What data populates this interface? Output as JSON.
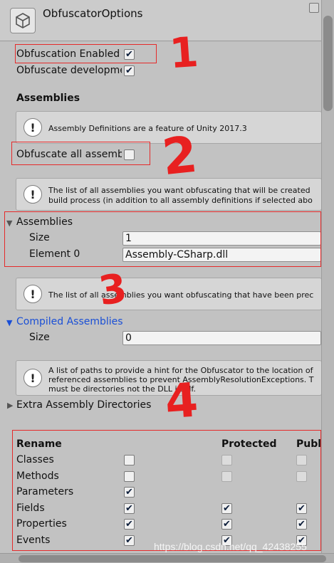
{
  "header": {
    "title": "ObfuscatorOptions",
    "icon": "unity-cube-icon"
  },
  "options": {
    "obfuscation_enabled_label": "Obfuscation Enabled",
    "obfuscate_dev_label": "Obfuscate developme",
    "obfuscation_enabled": true,
    "obfuscate_dev": true
  },
  "assemblies": {
    "heading": "Assemblies",
    "help1": "Assembly Definitions are a feature of Unity 2017.3",
    "obfuscate_all_label": "Obfuscate all assemb",
    "obfuscate_all": false,
    "help2_line1": "The list of all assemblies you want obfuscating that will be created",
    "help2_line2": "build process (in addition to all assembly definitions if selected abo",
    "list_label": "Assemblies",
    "size_label": "Size",
    "size_value": "1",
    "element0_label": "Element 0",
    "element0_value": "Assembly-CSharp.dll",
    "help3": "The list of all assemblies you want obfuscating that have been prec"
  },
  "compiled": {
    "label": "Compiled Assemblies",
    "size_label": "Size",
    "size_value": "0",
    "help_line1": "A list of paths to provide a hint for the Obfuscator to the location of",
    "help_line2": "referenced assemblies to prevent AssemblyResolutionExceptions. T",
    "help_line3": "must be directories not the DLL itself.",
    "extra_dirs_label": "Extra Assembly Directories"
  },
  "rename": {
    "headers": [
      "Rename",
      "Protected",
      "Publ"
    ],
    "rows": [
      {
        "label": "Classes",
        "c1": false,
        "c2": false,
        "c3": false,
        "c2_disabled": true,
        "c3_disabled": true
      },
      {
        "label": "Methods",
        "c1": false,
        "c2": false,
        "c3": false,
        "c2_disabled": true,
        "c3_disabled": true
      },
      {
        "label": "Parameters",
        "c1": true,
        "c2": null,
        "c3": null
      },
      {
        "label": "Fields",
        "c1": true,
        "c2": true,
        "c3": true
      },
      {
        "label": "Properties",
        "c1": true,
        "c2": true,
        "c3": true
      },
      {
        "label": "Events",
        "c1": true,
        "c2": true,
        "c3": true
      }
    ]
  },
  "annotations": {
    "n1": "1",
    "n2": "2",
    "n3": "3",
    "n4": "4",
    "color": "#e52a2a"
  },
  "watermark": "https://blog.csdn.net/qq_42438255",
  "colors": {
    "link_blue": "#1a4fd6",
    "panel_bg": "#c2c2c2"
  }
}
